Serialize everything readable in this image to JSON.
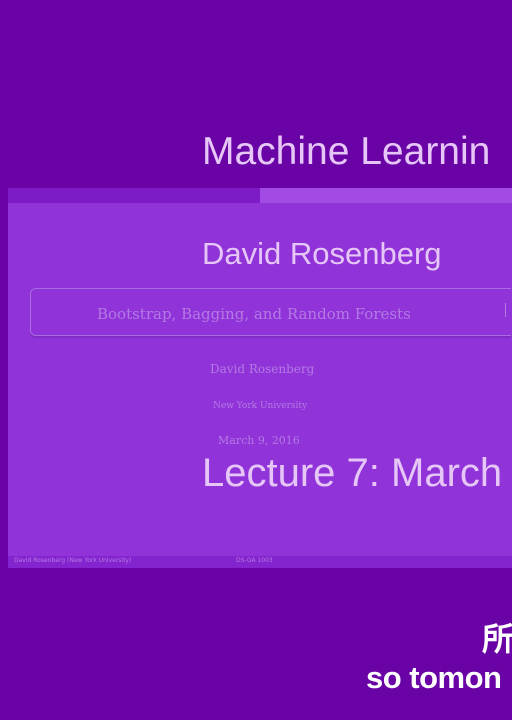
{
  "overlay": {
    "course_title": "Machine Learnin",
    "instructor": "David Rosenberg",
    "lecture": "Lecture 7:  March"
  },
  "slide": {
    "title": "Bootstrap, Bagging, and Random Forests",
    "author": "David Rosenberg",
    "institution": "New York University",
    "date": "March 9, 2016",
    "footer_left": "David Rosenberg (New York University)",
    "footer_mid": "DS-GA 1003"
  },
  "subtitles": {
    "cn_line": "所",
    "en_line": "so tomon"
  }
}
